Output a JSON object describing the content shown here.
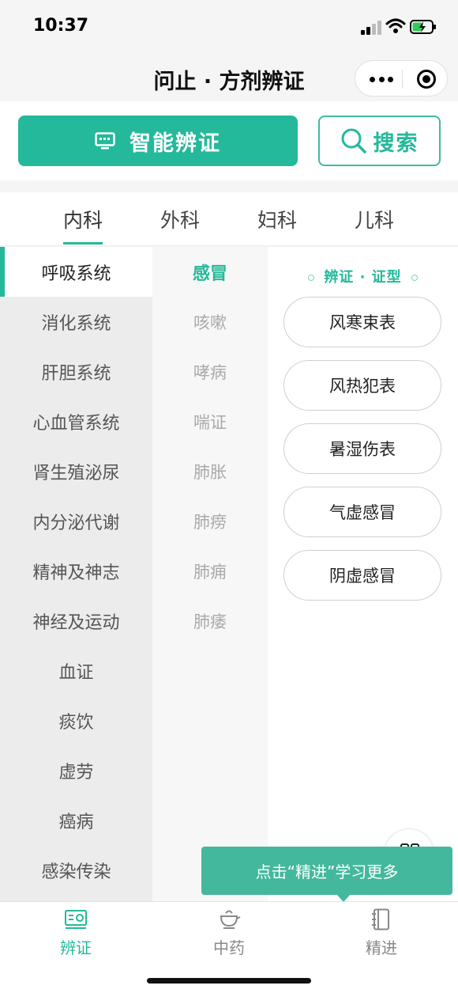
{
  "status_bar": {
    "time": "10:37"
  },
  "header": {
    "title": "问止 · 方剂辨证"
  },
  "actions": {
    "smart_label": "智能辨证",
    "search_label": "搜索"
  },
  "dept_tabs": [
    {
      "label": "内科",
      "active": true
    },
    {
      "label": "外科",
      "active": false
    },
    {
      "label": "妇科",
      "active": false
    },
    {
      "label": "儿科",
      "active": false
    }
  ],
  "systems": [
    {
      "label": "呼吸系统",
      "active": true
    },
    {
      "label": "消化系统"
    },
    {
      "label": "肝胆系统"
    },
    {
      "label": "心血管系统"
    },
    {
      "label": "肾生殖泌尿"
    },
    {
      "label": "内分泌代谢"
    },
    {
      "label": "精神及神志"
    },
    {
      "label": "神经及运动"
    },
    {
      "label": "血证"
    },
    {
      "label": "痰饮"
    },
    {
      "label": "虚劳"
    },
    {
      "label": "癌病"
    },
    {
      "label": "感染传染"
    }
  ],
  "diseases": [
    {
      "label": "感冒",
      "active": true
    },
    {
      "label": "咳嗽"
    },
    {
      "label": "哮病"
    },
    {
      "label": "喘证"
    },
    {
      "label": "肺胀"
    },
    {
      "label": "肺痨"
    },
    {
      "label": "肺痈"
    },
    {
      "label": "肺痿"
    }
  ],
  "syndrome_panel": {
    "header": "辨证 · 证型",
    "items": [
      "风寒束表",
      "风热犯表",
      "暑湿伤表",
      "气虚感冒",
      "阴虚感冒"
    ]
  },
  "tooltip": {
    "text": "点击“精进”学习更多"
  },
  "bottom_nav": [
    {
      "label": "辨证",
      "icon": "dialectic-icon",
      "active": true
    },
    {
      "label": "中药",
      "icon": "herb-pot-icon"
    },
    {
      "label": "精进",
      "icon": "notebook-icon"
    }
  ],
  "colors": {
    "accent": "#24b99a",
    "tooltip": "#43b89d"
  }
}
